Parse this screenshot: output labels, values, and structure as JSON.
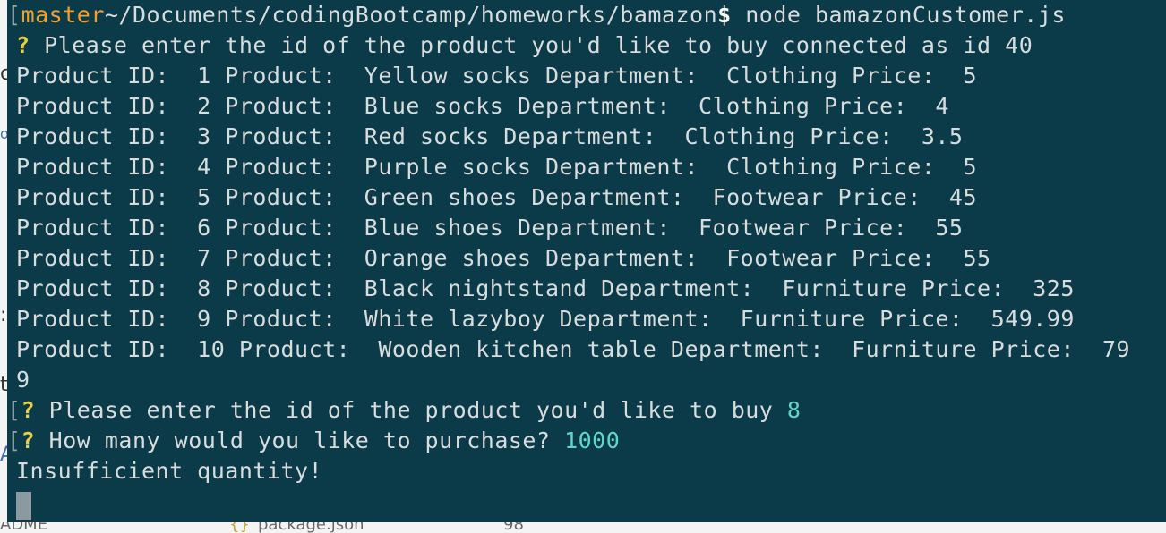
{
  "editor_edge": {
    "glyphs": [
      "c",
      "o",
      ":",
      "t",
      "A"
    ],
    "bottom_texts": [
      "ADME",
      "{}",
      "package.json",
      "98"
    ]
  },
  "terminal": {
    "branch": "master",
    "path": "~/Documents/codingBootcamp/homeworks/bamazon",
    "prompt_symbol": "$",
    "command": " node bamazonCustomer.js",
    "first_prompt": {
      "qmark": "?",
      "text": " Please enter the id of the product you'd like to buy connected as id 40"
    },
    "products": [
      "Product ID:  1 Product:  Yellow socks Department:  Clothing Price:  5",
      "Product ID:  2 Product:  Blue socks Department:  Clothing Price:  4",
      "Product ID:  3 Product:  Red socks Department:  Clothing Price:  3.5",
      "Product ID:  4 Product:  Purple socks Department:  Clothing Price:  5",
      "Product ID:  5 Product:  Green shoes Department:  Footwear Price:  45",
      "Product ID:  6 Product:  Blue shoes Department:  Footwear Price:  55",
      "Product ID:  7 Product:  Orange shoes Department:  Footwear Price:  55",
      "Product ID:  8 Product:  Black nightstand Department:  Furniture Price:  325",
      "Product ID:  9 Product:  White lazyboy Department:  Furniture Price:  549.99",
      "Product ID:  10 Product:  Wooden kitchen table Department:  Furniture Price:  79",
      "9"
    ],
    "second_prompt": {
      "qmark": "?",
      "text": " Please enter the id of the product you'd like to buy ",
      "answer": "8"
    },
    "third_prompt": {
      "qmark": "?",
      "text": " How many would you like to purchase? ",
      "answer": "1000"
    },
    "result": "Insufficient quantity!"
  },
  "colors": {
    "background": "#0b3a48",
    "text": "#d8dcdc",
    "branch": "#f0a030",
    "qmark": "#e8d045",
    "answer": "#5fd7c8"
  }
}
